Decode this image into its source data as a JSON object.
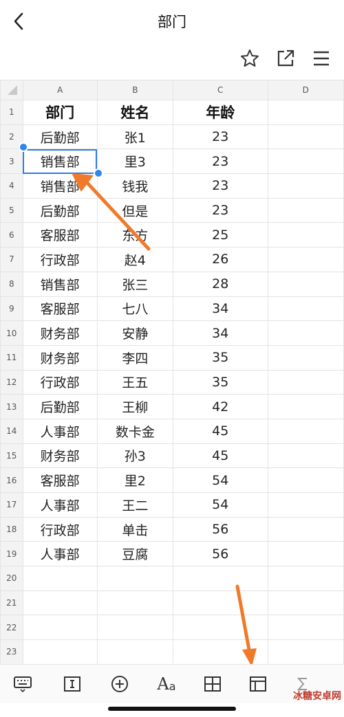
{
  "header": {
    "title": "部门"
  },
  "columns": [
    "A",
    "B",
    "C",
    "D"
  ],
  "rows": [
    {
      "n": "1",
      "a": "部门",
      "b": "姓名",
      "c": "年龄"
    },
    {
      "n": "2",
      "a": "后勤部",
      "b": "张1",
      "c": "23"
    },
    {
      "n": "3",
      "a": "销售部",
      "b": "里3",
      "c": "23"
    },
    {
      "n": "4",
      "a": "销售部",
      "b": "钱我",
      "c": "23"
    },
    {
      "n": "5",
      "a": "后勤部",
      "b": "但是",
      "c": "23"
    },
    {
      "n": "6",
      "a": "客服部",
      "b": "东方",
      "c": "25"
    },
    {
      "n": "7",
      "a": "行政部",
      "b": "赵4",
      "c": "26"
    },
    {
      "n": "8",
      "a": "销售部",
      "b": "张三",
      "c": "28"
    },
    {
      "n": "9",
      "a": "客服部",
      "b": "七八",
      "c": "34"
    },
    {
      "n": "10",
      "a": "财务部",
      "b": "安静",
      "c": "34"
    },
    {
      "n": "11",
      "a": "财务部",
      "b": "李四",
      "c": "35"
    },
    {
      "n": "12",
      "a": "行政部",
      "b": "王五",
      "c": "35"
    },
    {
      "n": "13",
      "a": "后勤部",
      "b": "王柳",
      "c": "42"
    },
    {
      "n": "14",
      "a": "人事部",
      "b": "数卡金",
      "c": "45"
    },
    {
      "n": "15",
      "a": "财务部",
      "b": "孙3",
      "c": "45"
    },
    {
      "n": "16",
      "a": "客服部",
      "b": "里2",
      "c": "54"
    },
    {
      "n": "17",
      "a": "人事部",
      "b": "王二",
      "c": "54"
    },
    {
      "n": "18",
      "a": "行政部",
      "b": "单击",
      "c": "56"
    },
    {
      "n": "19",
      "a": "人事部",
      "b": "豆腐",
      "c": "56"
    },
    {
      "n": "20",
      "a": "",
      "b": "",
      "c": ""
    },
    {
      "n": "21",
      "a": "",
      "b": "",
      "c": ""
    },
    {
      "n": "22",
      "a": "",
      "b": "",
      "c": ""
    },
    {
      "n": "23",
      "a": "",
      "b": "",
      "c": ""
    }
  ],
  "selected_cell": "A3",
  "icons": {
    "back": "chevron-left-icon",
    "star": "star-icon",
    "share": "share-icon",
    "menu": "menu-icon",
    "toolbar": [
      "keyboard-icon",
      "text-cursor-icon",
      "plus-circle-icon",
      "font-icon",
      "table-border-icon",
      "freeze-panes-icon",
      "formula-icon"
    ]
  },
  "colors": {
    "selection": "#2f7ae5",
    "annotation_arrow": "#f07a2a"
  },
  "watermark": {
    "text": "冰糖安卓网",
    "url": "www.btxtdmy.com"
  }
}
